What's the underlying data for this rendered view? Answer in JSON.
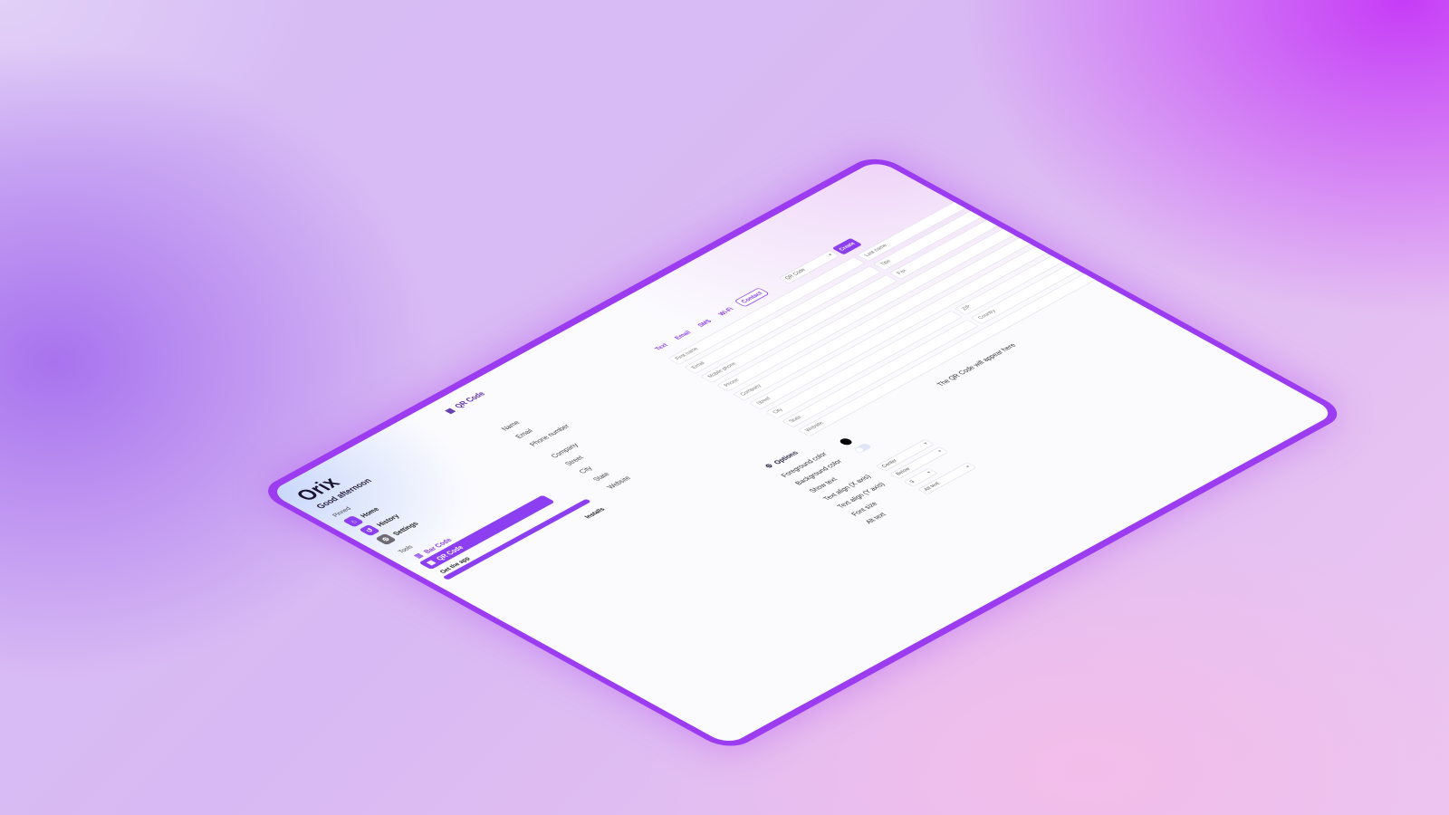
{
  "app": {
    "logo": "Orix",
    "greeting": "Good afternoon"
  },
  "sidebar": {
    "pinned_label": "Pinned",
    "pinned": [
      {
        "label": "Home",
        "icon": "home-icon"
      },
      {
        "label": "History",
        "icon": "history-icon"
      },
      {
        "label": "Settings",
        "icon": "settings-icon"
      }
    ],
    "tools_label": "Tools",
    "tools": [
      {
        "label": "Bar Code",
        "icon": "barcode-icon"
      },
      {
        "label": "QR Code",
        "icon": "qr-icon"
      }
    ],
    "footer": "Get the app",
    "installs": "Installs"
  },
  "main": {
    "title": "QR Code",
    "preview_labels": [
      "Name",
      "Email",
      "Phone number",
      "Company",
      "Street",
      "City",
      "State",
      "Website"
    ],
    "tabs": [
      "Text",
      "Email",
      "SMS",
      "Wi-Fi",
      "Contact"
    ],
    "select_value": "QR Code",
    "create_label": "Create",
    "fields": {
      "first_name": "First name",
      "last_name": "Last name",
      "email": "Email",
      "title": "Title",
      "mobile": "Mobile phone",
      "fax": "Fax",
      "phone": "Phone",
      "company": "Company",
      "street": "Street",
      "city": "City",
      "zip": "ZIP",
      "state": "State",
      "country": "Country",
      "website": "Website"
    },
    "qr_note": "The QR Code will appear here"
  },
  "options": {
    "title": "Options",
    "foreground_label": "Foreground color",
    "background_label": "Background color",
    "show_text_label": "Show text",
    "text_align_x_label": "Text align (X axis)",
    "text_align_x_value": "Center",
    "text_align_y_label": "Text align (Y axis)",
    "text_align_y_value": "Below",
    "font_size_label": "Font size",
    "font_size_value": "9",
    "alt_text_label": "Alt text",
    "alt_text_placeholder": "Alt text"
  },
  "colors": {
    "accent": "#8b3ff0",
    "frame": "#9c3cf0"
  }
}
